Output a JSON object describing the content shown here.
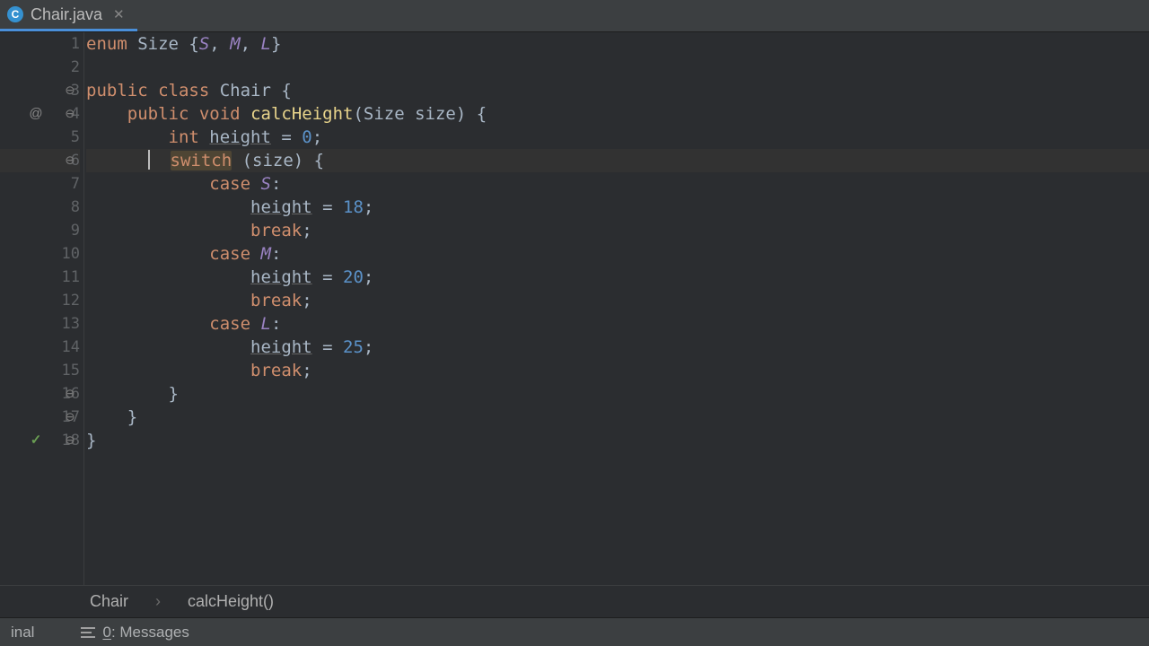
{
  "tab": {
    "icon_letter": "C",
    "label": "Chair.java"
  },
  "lines": [
    "1",
    "2",
    "3",
    "4",
    "5",
    "6",
    "7",
    "8",
    "9",
    "10",
    "11",
    "12",
    "13",
    "14",
    "15",
    "16",
    "17",
    "18"
  ],
  "annotations": {
    "line4": "@",
    "line18": "✓"
  },
  "code": {
    "l1": {
      "a": "enum",
      "b": " Size {",
      "s": "S",
      "c": ", ",
      "m": "M",
      "d": ", ",
      "l": "L",
      "e": "}"
    },
    "l3": {
      "a": "public class",
      "b": " Chair {"
    },
    "l4": {
      "a": "public void",
      "sp": " ",
      "m": "calcHeight",
      "p1": "(Size size) {"
    },
    "l5": {
      "a": "int",
      "sp": " ",
      "h": "height",
      "eq": " = ",
      "n": "0",
      "end": ";"
    },
    "l6": {
      "sw": "switch",
      "rest": " (size) {"
    },
    "l7": {
      "a": "case",
      "sp": " ",
      "v": "S",
      "c": ":"
    },
    "l8": {
      "h": "height",
      "eq": " = ",
      "n": "18",
      "end": ";"
    },
    "l9": {
      "a": "break",
      "end": ";"
    },
    "l10": {
      "a": "case",
      "sp": " ",
      "v": "M",
      "c": ":"
    },
    "l11": {
      "h": "height",
      "eq": " = ",
      "n": "20",
      "end": ";"
    },
    "l12": {
      "a": "break",
      "end": ";"
    },
    "l13": {
      "a": "case",
      "sp": " ",
      "v": "L",
      "c": ":"
    },
    "l14": {
      "h": "height",
      "eq": " = ",
      "n": "25",
      "end": ";"
    },
    "l15": {
      "a": "break",
      "end": ";"
    },
    "l16": "        }",
    "l17": "    }",
    "l18": "}"
  },
  "breadcrumb": {
    "a": "Chair",
    "b": "calcHeight()"
  },
  "bottom": {
    "terminal": "inal",
    "messages_num": "0",
    "messages_label": ": Messages"
  }
}
